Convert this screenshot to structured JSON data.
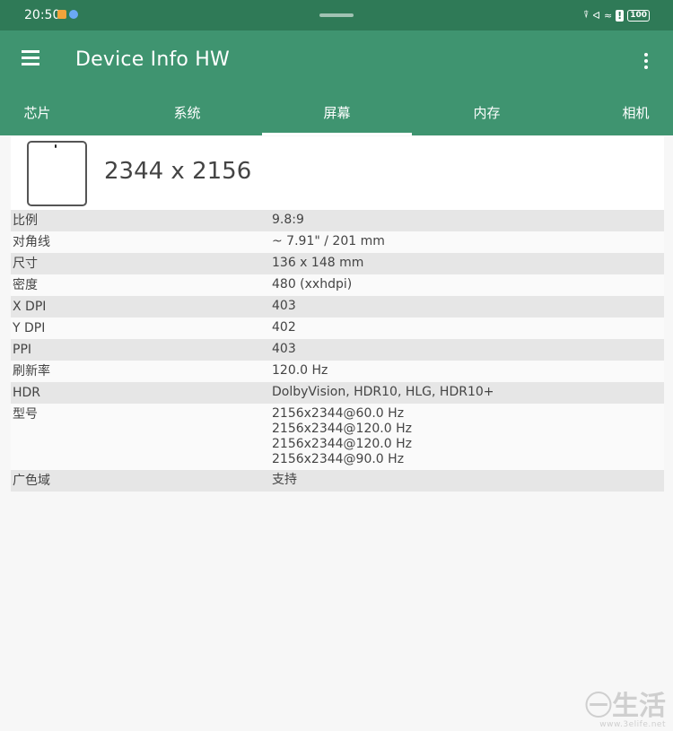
{
  "status": {
    "time": "20:50",
    "battery": "100",
    "apps": [
      "#f2a33a",
      "#6aa9f4"
    ],
    "icons": [
      "nfc-icon",
      "bluetooth-icon",
      "wifi-icon",
      "alert-icon",
      "battery-icon"
    ]
  },
  "app": {
    "title": "Device Info HW"
  },
  "tabs": [
    "芯片",
    "系统",
    "屏幕",
    "内存",
    "相机"
  ],
  "active_tab": "屏幕",
  "screen": {
    "resolution": "2344 x 2156"
  },
  "rows": [
    {
      "label": "比例",
      "values": [
        "9.8:9"
      ]
    },
    {
      "label": "对角线",
      "values": [
        "~ 7.91\" / 201 mm"
      ]
    },
    {
      "label": "尺寸",
      "values": [
        "136 x 148 mm"
      ]
    },
    {
      "label": "密度",
      "values": [
        "480 (xxhdpi)"
      ]
    },
    {
      "label": "X DPI",
      "values": [
        "403"
      ]
    },
    {
      "label": "Y DPI",
      "values": [
        "402"
      ]
    },
    {
      "label": "PPI",
      "values": [
        "403"
      ]
    },
    {
      "label": "刷新率",
      "values": [
        "120.0 Hz"
      ]
    },
    {
      "label": "HDR",
      "values": [
        "DolbyVision, HDR10, HLG, HDR10+"
      ]
    },
    {
      "label": "型号",
      "values": [
        "2156x2344@60.0 Hz",
        "2156x2344@120.0 Hz",
        "2156x2344@120.0 Hz",
        "2156x2344@90.0 Hz"
      ]
    },
    {
      "label": "广色域",
      "values": [
        "支持"
      ]
    }
  ],
  "watermark": {
    "main": "㊀生活",
    "sub": "www.3elife.net"
  },
  "colors": {
    "status_bar": "#2f7a57",
    "app_bar": "#3f9470",
    "accent": "#ffffff"
  }
}
